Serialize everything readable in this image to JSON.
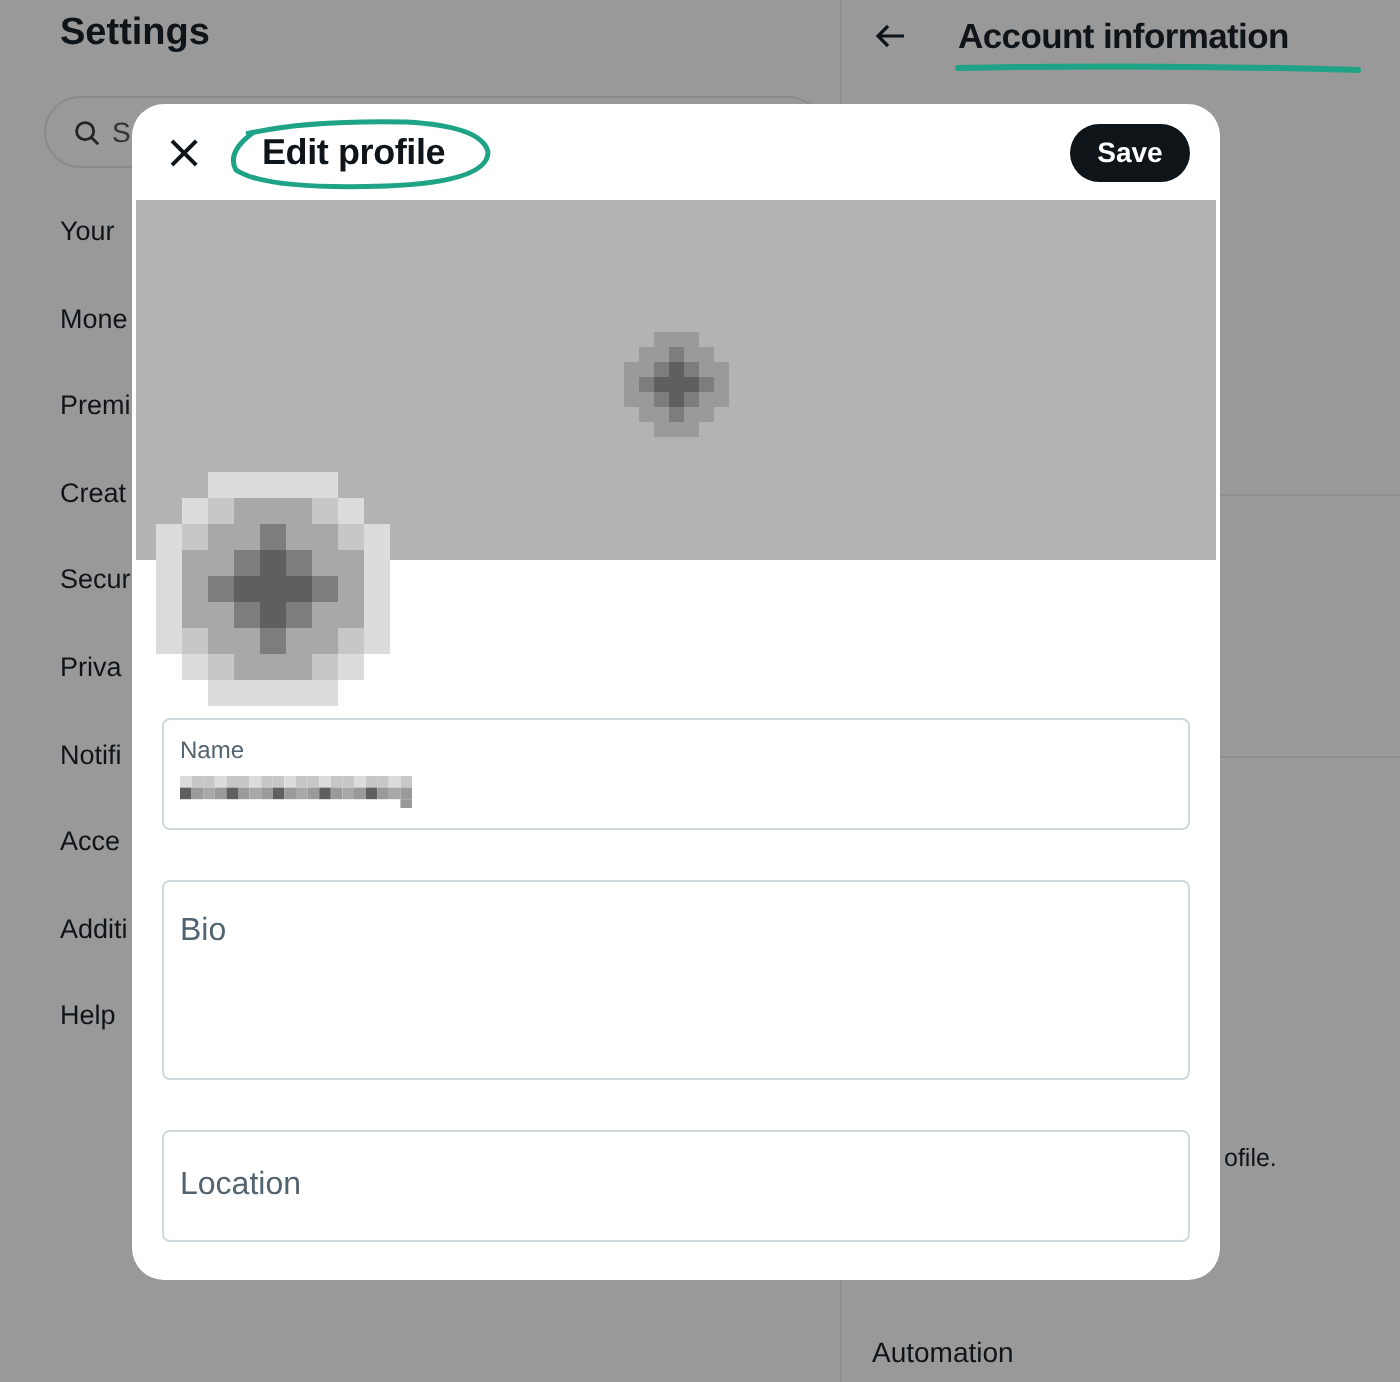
{
  "settings": {
    "title": "Settings",
    "search": {
      "placeholder": "S"
    },
    "items": [
      {
        "label": "Your"
      },
      {
        "label": "Mone"
      },
      {
        "label": "Premi"
      },
      {
        "label": "Creat"
      },
      {
        "label": "Secur"
      },
      {
        "label": "Priva"
      },
      {
        "label": "Notifi"
      },
      {
        "label": "Acce"
      },
      {
        "label": "Additi"
      },
      {
        "label": "Help"
      }
    ]
  },
  "account": {
    "title": "Account information",
    "texts": [
      {
        "text": "ofile."
      },
      {
        "text": "Automation"
      }
    ]
  },
  "dialog": {
    "title": "Edit profile",
    "save": "Save",
    "close": "×",
    "fields": [
      {
        "kind": "filled",
        "label": "Name"
      },
      {
        "kind": "textarea",
        "placeholder": "Bio"
      },
      {
        "kind": "input",
        "placeholder": "Location"
      }
    ]
  }
}
